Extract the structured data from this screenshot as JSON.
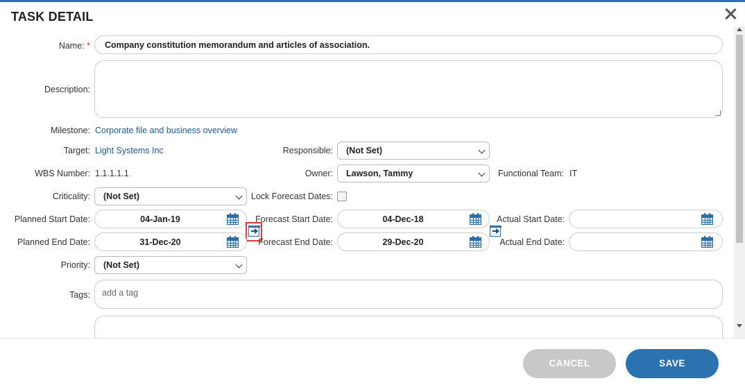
{
  "dialog": {
    "title": "TASK DETAIL"
  },
  "form": {
    "name_label": "Name:",
    "name_required": "*",
    "name_value": "Company constitution memorandum and articles of association.",
    "description_label": "Description:",
    "description_value": "",
    "milestone_label": "Milestone:",
    "milestone_value": "Corporate file and business overview",
    "target_label": "Target:",
    "target_value": "Light Systems Inc",
    "responsible_label": "Responsible:",
    "responsible_value": "(Not Set)",
    "wbs_label": "WBS Number:",
    "wbs_value": "1.1.1.1.1",
    "owner_label": "Owner:",
    "owner_value": "Lawson, Tammy",
    "team_label": "Functional Team:",
    "team_value": "IT",
    "criticality_label": "Criticality:",
    "criticality_value": "(Not Set)",
    "lock_label": "Lock Forecast Dates:",
    "lock_checked": false,
    "planned_start_label": "Planned Start Date:",
    "planned_start_value": "04-Jan-19",
    "forecast_start_label": "Forecast Start Date:",
    "forecast_start_value": "04-Dec-18",
    "actual_start_label": "Actual Start Date:",
    "actual_start_value": "",
    "planned_end_label": "Planned End Date:",
    "planned_end_value": "31-Dec-20",
    "forecast_end_label": "Forecast End Date:",
    "forecast_end_value": "29-Dec-20",
    "actual_end_label": "Actual End Date:",
    "actual_end_value": "",
    "priority_label": "Priority:",
    "priority_value": "(Not Set)",
    "tags_label": "Tags:",
    "tags_placeholder": "add a tag"
  },
  "footer": {
    "cancel_label": "CANCEL",
    "save_label": "SAVE"
  },
  "colors": {
    "accent": "#2a72b0",
    "link": "#1f5a96",
    "highlight": "#e53935",
    "required": "#c0392b"
  },
  "icons": [
    "close-icon",
    "calendar-icon",
    "copy-date-arrow-icon",
    "chevron-down-icon"
  ]
}
